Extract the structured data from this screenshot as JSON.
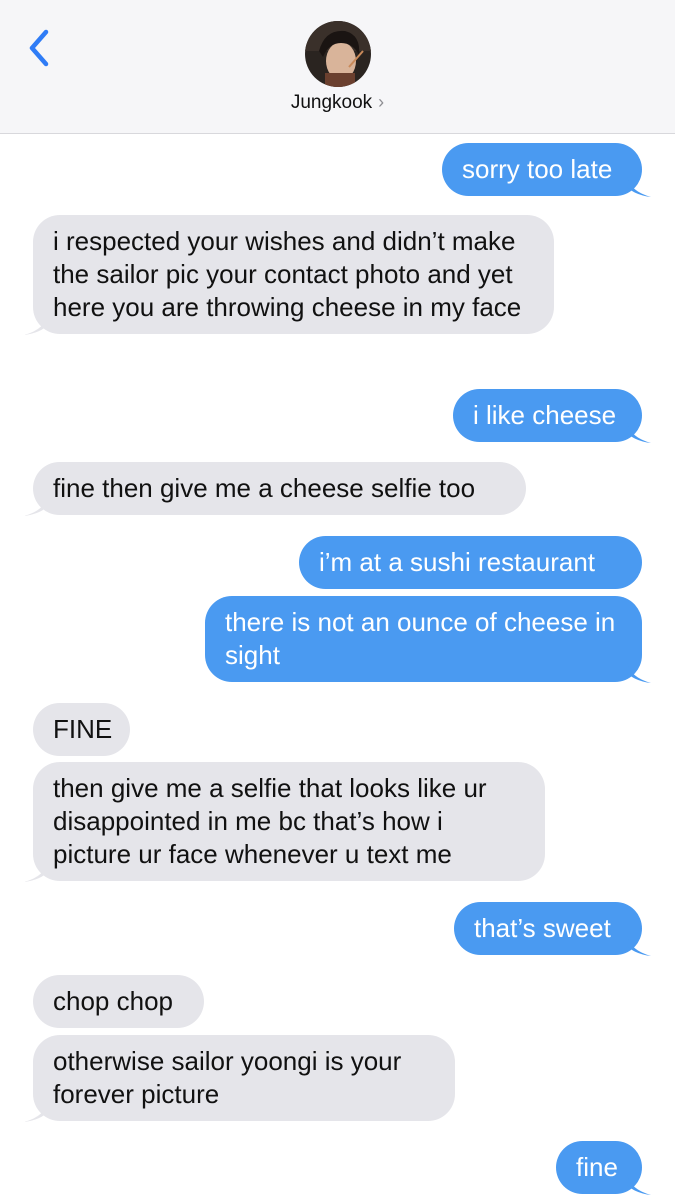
{
  "header": {
    "contact_name": "Jungkook",
    "chevron": "›",
    "back_icon": "chevron-left-icon",
    "accent": "#2f7cf6"
  },
  "colors": {
    "outgoing": "#4a9af1",
    "incoming": "#e5e5ea"
  },
  "messages": [
    {
      "dir": "out",
      "text": "sorry too late"
    },
    {
      "dir": "in",
      "text": "i respected your wishes and didn’t make the sailor pic your contact photo and yet here you are throwing cheese in my face"
    },
    {
      "dir": "out",
      "text": "i like cheese"
    },
    {
      "dir": "in",
      "text": "fine then give me a cheese selfie too"
    },
    {
      "dir": "out",
      "text": "i’m at a sushi restaurant"
    },
    {
      "dir": "out",
      "text": "there is not an ounce of cheese in sight"
    },
    {
      "dir": "in",
      "text": "FINE"
    },
    {
      "dir": "in",
      "text": "then give me a selfie that looks like ur disappointed in me bc that’s how i picture ur face whenever u text me"
    },
    {
      "dir": "out",
      "text": "that’s sweet"
    },
    {
      "dir": "in",
      "text": "chop chop"
    },
    {
      "dir": "in",
      "text": "otherwise sailor yoongi is your forever picture"
    },
    {
      "dir": "out",
      "text": "fine"
    }
  ]
}
